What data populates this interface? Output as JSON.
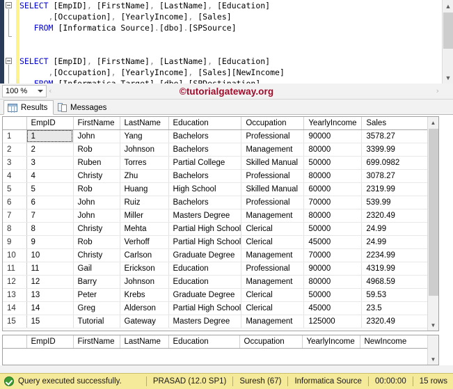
{
  "editor": {
    "zoom_level": "100 %",
    "scroll_left_glyph": "‹",
    "scroll_right_glyph": "›",
    "watermark": "©tutorialgateway.org",
    "lines": [
      {
        "indent": 0,
        "segments": [
          {
            "t": "SELECT ",
            "c": "kw"
          },
          {
            "t": "[EmpID]",
            "c": "brk"
          },
          {
            "t": ", ",
            "c": "punct"
          },
          {
            "t": "[FirstName]",
            "c": "brk"
          },
          {
            "t": ", ",
            "c": "punct"
          },
          {
            "t": "[LastName]",
            "c": "brk"
          },
          {
            "t": ", ",
            "c": "punct"
          },
          {
            "t": "[Education]",
            "c": "brk"
          }
        ]
      },
      {
        "indent": 6,
        "segments": [
          {
            "t": ",",
            "c": "punct"
          },
          {
            "t": "[Occupation]",
            "c": "brk"
          },
          {
            "t": ", ",
            "c": "punct"
          },
          {
            "t": "[YearlyIncome]",
            "c": "brk"
          },
          {
            "t": ", ",
            "c": "punct"
          },
          {
            "t": "[Sales]",
            "c": "brk"
          }
        ]
      },
      {
        "indent": 3,
        "segments": [
          {
            "t": "FROM ",
            "c": "kw"
          },
          {
            "t": "[Informatica Source]",
            "c": "brk"
          },
          {
            "t": ".",
            "c": "punct"
          },
          {
            "t": "[dbo]",
            "c": "brk"
          },
          {
            "t": ".",
            "c": "punct"
          },
          {
            "t": "[SPSource]",
            "c": "brk"
          }
        ]
      },
      {
        "indent": 0,
        "segments": []
      },
      {
        "indent": 0,
        "segments": []
      },
      {
        "indent": 0,
        "segments": [
          {
            "t": "SELECT ",
            "c": "kw"
          },
          {
            "t": "[EmpID]",
            "c": "brk"
          },
          {
            "t": ", ",
            "c": "punct"
          },
          {
            "t": "[FirstName]",
            "c": "brk"
          },
          {
            "t": ", ",
            "c": "punct"
          },
          {
            "t": "[LastName]",
            "c": "brk"
          },
          {
            "t": ", ",
            "c": "punct"
          },
          {
            "t": "[Education]",
            "c": "brk"
          }
        ]
      },
      {
        "indent": 6,
        "segments": [
          {
            "t": ",",
            "c": "punct"
          },
          {
            "t": "[Occupation]",
            "c": "brk"
          },
          {
            "t": ", ",
            "c": "punct"
          },
          {
            "t": "[YearlyIncome]",
            "c": "brk"
          },
          {
            "t": ", ",
            "c": "punct"
          },
          {
            "t": "[Sales]",
            "c": "brk"
          },
          {
            "t": "[NewIncome]",
            "c": "brk"
          }
        ]
      },
      {
        "indent": 3,
        "segments": [
          {
            "t": "FROM ",
            "c": "kw"
          },
          {
            "t": "[Informatica Target]",
            "c": "brk"
          },
          {
            "t": ".",
            "c": "punct"
          },
          {
            "t": "[dbo]",
            "c": "brk"
          },
          {
            "t": ".",
            "c": "punct"
          },
          {
            "t": "[SPDestination]",
            "c": "brk"
          }
        ]
      }
    ]
  },
  "tabs": [
    {
      "label": "Results",
      "icon": "results-grid-icon",
      "active": true
    },
    {
      "label": "Messages",
      "icon": "messages-icon",
      "active": false
    }
  ],
  "result_grid_1": {
    "columns": [
      "EmpID",
      "FirstName",
      "LastName",
      "Education",
      "Occupation",
      "YearlyIncome",
      "Sales"
    ],
    "rows": [
      {
        "n": "1",
        "cells": [
          "1",
          "John",
          "Yang",
          "Bachelors",
          "Professional",
          "90000",
          "3578.27"
        ]
      },
      {
        "n": "2",
        "cells": [
          "2",
          "Rob",
          "Johnson",
          "Bachelors",
          "Management",
          "80000",
          "3399.99"
        ]
      },
      {
        "n": "3",
        "cells": [
          "3",
          "Ruben",
          "Torres",
          "Partial College",
          "Skilled Manual",
          "50000",
          "699.0982"
        ]
      },
      {
        "n": "4",
        "cells": [
          "4",
          "Christy",
          "Zhu",
          "Bachelors",
          "Professional",
          "80000",
          "3078.27"
        ]
      },
      {
        "n": "5",
        "cells": [
          "5",
          "Rob",
          "Huang",
          "High School",
          "Skilled Manual",
          "60000",
          "2319.99"
        ]
      },
      {
        "n": "6",
        "cells": [
          "6",
          "John",
          "Ruiz",
          "Bachelors",
          "Professional",
          "70000",
          "539.99"
        ]
      },
      {
        "n": "7",
        "cells": [
          "7",
          "John",
          "Miller",
          "Masters Degree",
          "Management",
          "80000",
          "2320.49"
        ]
      },
      {
        "n": "8",
        "cells": [
          "8",
          "Christy",
          "Mehta",
          "Partial High School",
          "Clerical",
          "50000",
          "24.99"
        ]
      },
      {
        "n": "9",
        "cells": [
          "9",
          "Rob",
          "Verhoff",
          "Partial High School",
          "Clerical",
          "45000",
          "24.99"
        ]
      },
      {
        "n": "10",
        "cells": [
          "10",
          "Christy",
          "Carlson",
          "Graduate Degree",
          "Management",
          "70000",
          "2234.99"
        ]
      },
      {
        "n": "11",
        "cells": [
          "11",
          "Gail",
          "Erickson",
          "Education",
          "Professional",
          "90000",
          "4319.99"
        ]
      },
      {
        "n": "12",
        "cells": [
          "12",
          "Barry",
          "Johnson",
          "Education",
          "Management",
          "80000",
          "4968.59"
        ]
      },
      {
        "n": "13",
        "cells": [
          "13",
          "Peter",
          "Krebs",
          "Graduate Degree",
          "Clerical",
          "50000",
          "59.53"
        ]
      },
      {
        "n": "14",
        "cells": [
          "14",
          "Greg",
          "Alderson",
          "Partial High School",
          "Clerical",
          "45000",
          "23.5"
        ]
      },
      {
        "n": "15",
        "cells": [
          "15",
          "Tutorial",
          "Gateway",
          "Masters Degree",
          "Management",
          "125000",
          "2320.49"
        ]
      }
    ]
  },
  "result_grid_2": {
    "columns": [
      "EmpID",
      "FirstName",
      "LastName",
      "Education",
      "Occupation",
      "YearlyIncome",
      "NewIncome"
    ],
    "rows": []
  },
  "statusbar": {
    "icon": "success-check-icon",
    "message": "Query executed successfully.",
    "server": "PRASAD (12.0 SP1)",
    "user": "Suresh (67)",
    "database": "Informatica Source",
    "elapsed": "00:00:00",
    "row_count": "15 rows"
  }
}
